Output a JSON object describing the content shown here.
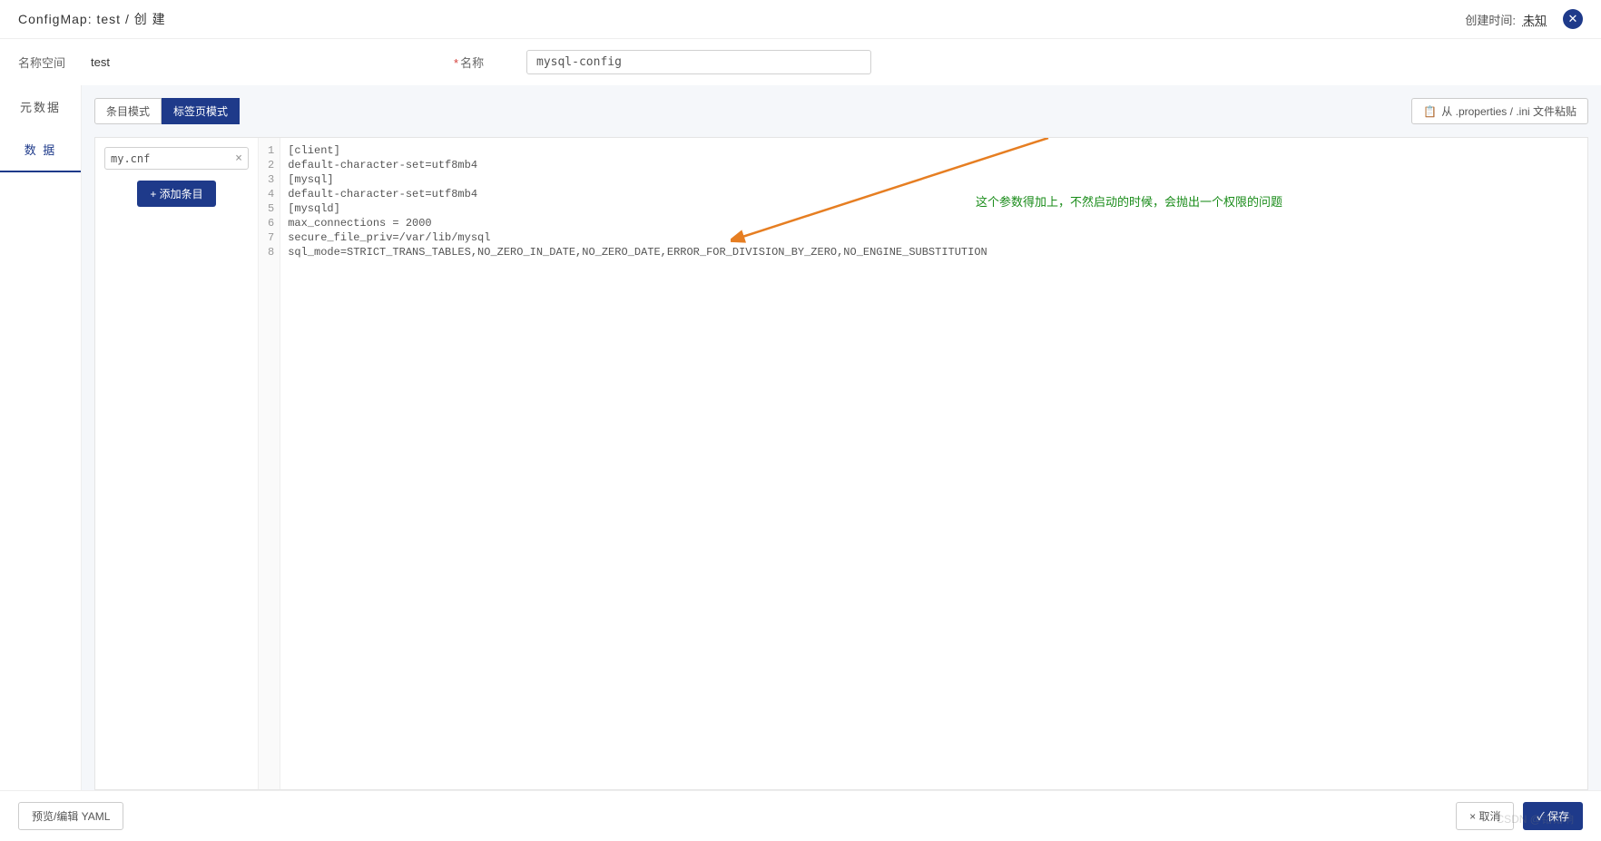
{
  "header": {
    "breadcrumb": "ConfigMap: test / 创 建",
    "created_label": "创建时间:",
    "created_value": "未知"
  },
  "form": {
    "namespace_label": "名称空间",
    "namespace_value": "test",
    "name_label": "名称",
    "name_value": "mysql-config"
  },
  "sidebar": {
    "tabs": [
      {
        "label": "元数据"
      },
      {
        "label": "数 据"
      }
    ]
  },
  "toolbar": {
    "mode_list": "条目模式",
    "mode_tab": "标签页模式",
    "paste_label": "从 .properties / .ini 文件粘贴"
  },
  "entries": {
    "items": [
      {
        "name": "my.cnf"
      }
    ],
    "add_label": "+ 添加条目"
  },
  "editor": {
    "lines": [
      "[client]",
      "default-character-set=utf8mb4",
      "[mysql]",
      "default-character-set=utf8mb4",
      "[mysqld]",
      "max_connections = 2000",
      "secure_file_priv=/var/lib/mysql",
      "sql_mode=STRICT_TRANS_TABLES,NO_ZERO_IN_DATE,NO_ZERO_DATE,ERROR_FOR_DIVISION_BY_ZERO,NO_ENGINE_SUBSTITUTION"
    ]
  },
  "annotation": {
    "text": "这个参数得加上，不然启动的时候，会抛出一个权限的问题"
  },
  "footer": {
    "preview_label": "预览/编辑 YAML",
    "cancel_label": "× 取消",
    "save_label": "✓ 保存"
  },
  "watermark": "CSDN @铭铭响"
}
